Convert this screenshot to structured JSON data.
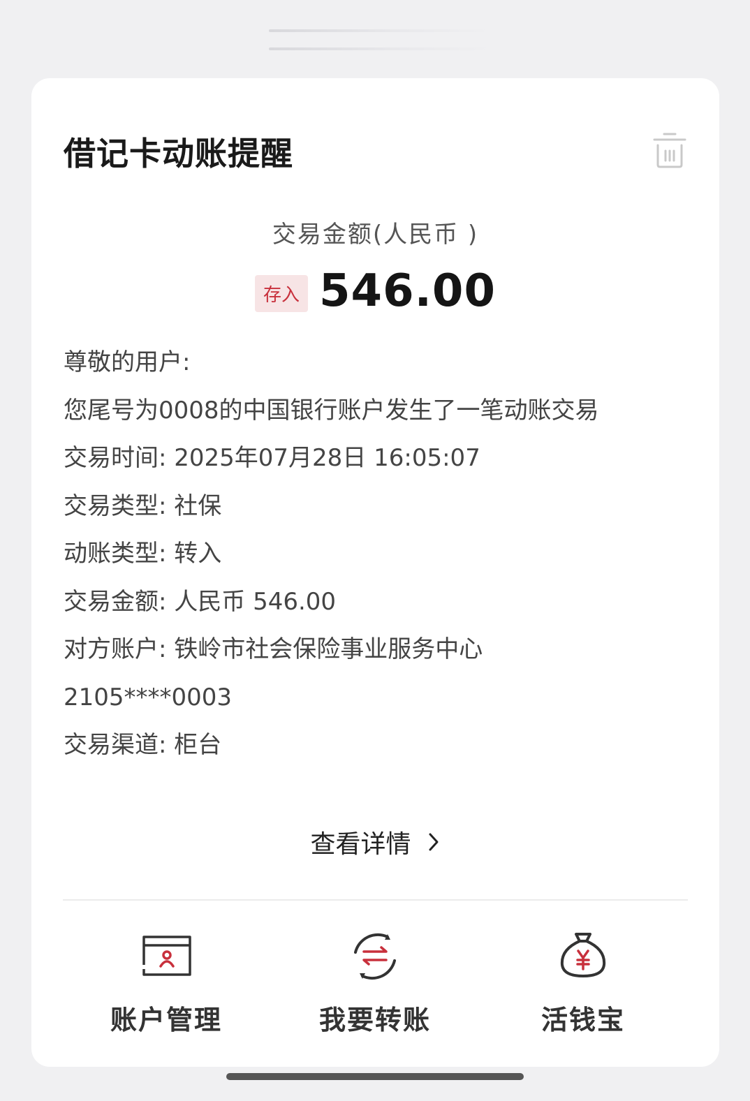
{
  "card": {
    "title": "借记卡动账提醒",
    "amount_caption": "交易金额(人民币 )",
    "deposit_badge": "存入",
    "amount": "546.00"
  },
  "message": {
    "greeting": "尊敬的用户:",
    "intro": "您尾号为0008的中国银行账户发生了一笔动账交易",
    "time": "交易时间: 2025年07月28日 16:05:07",
    "type": "交易类型: 社保",
    "movement": "动账类型: 转入",
    "amount": "交易金额: 人民币 546.00",
    "counterparty": "对方账户: 铁岭市社会保险事业服务中心",
    "counterparty_account": "2105****0003",
    "channel": "交易渠道: 柜台"
  },
  "details_link": "查看详情",
  "actions": [
    {
      "label": "账户管理",
      "icon": "account-card-icon"
    },
    {
      "label": "我要转账",
      "icon": "transfer-arrows-icon"
    },
    {
      "label": "活钱宝",
      "icon": "money-bag-icon"
    }
  ],
  "colors": {
    "accent": "#c8303c",
    "badge_bg": "#f7e4e5",
    "card_bg": "#ffffff",
    "page_bg": "#f0f0f2"
  }
}
